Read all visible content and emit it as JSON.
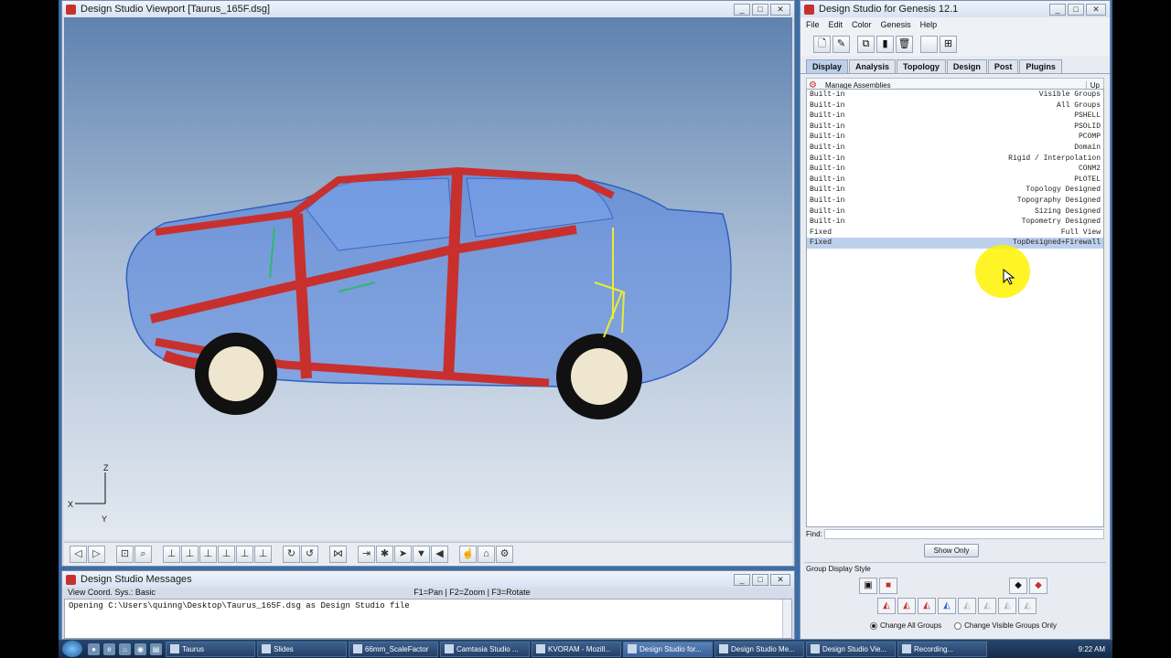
{
  "viewport": {
    "title": "Design Studio Viewport [Taurus_165F.dsg]",
    "axes": {
      "z": "Z",
      "x": "X",
      "y": "Y"
    }
  },
  "messages": {
    "title": "Design Studio Messages",
    "coord_sys": "View Coord. Sys.: Basic",
    "hotkeys": "F1=Pan | F2=Zoom | F3=Rotate",
    "log_line": "Opening C:\\Users\\quinng\\Desktop\\Taurus_165F.dsg as Design Studio file"
  },
  "genesis": {
    "title": "Design Studio for Genesis 12.1",
    "menu": [
      "File",
      "Edit",
      "Color",
      "Genesis",
      "Help"
    ],
    "tabs": [
      "Display",
      "Analysis",
      "Topology",
      "Design",
      "Post",
      "Plugins"
    ],
    "active_tab": "Display",
    "manage_assemblies": "Manage Assemblies",
    "up_label": "Up",
    "groups": [
      {
        "type": "Built-in",
        "name": "Visible Groups"
      },
      {
        "type": "Built-in",
        "name": "All Groups"
      },
      {
        "type": "Built-in",
        "name": "PSHELL"
      },
      {
        "type": "Built-in",
        "name": "PSOLID"
      },
      {
        "type": "Built-in",
        "name": "PCOMP"
      },
      {
        "type": "Built-in",
        "name": "Domain"
      },
      {
        "type": "Built-in",
        "name": "Rigid / Interpolation"
      },
      {
        "type": "Built-in",
        "name": "CONM2"
      },
      {
        "type": "Built-in",
        "name": "PLOTEL"
      },
      {
        "type": "Built-in",
        "name": "Topology Designed"
      },
      {
        "type": "Built-in",
        "name": "Topography Designed"
      },
      {
        "type": "Built-in",
        "name": "Sizing Designed"
      },
      {
        "type": "Built-in",
        "name": "Topometry Designed"
      },
      {
        "type": "Fixed",
        "name": "Full View"
      },
      {
        "type": "Fixed",
        "name": "TopDesigned+Firewall"
      }
    ],
    "find_label": "Find:",
    "find_value": "",
    "show_only": "Show Only",
    "group_display_style": "Group Display Style",
    "radio_all": "Change All Groups",
    "radio_visible": "Change Visible Groups Only"
  },
  "taskbar": {
    "items": [
      "Taurus",
      "Slides",
      "66mm_ScaleFactor",
      "Camtasia Studio ...",
      "KVORAM - Mozill...",
      "Design Studio for...",
      "Design Studio Me...",
      "Design Studio Vie...",
      "Recording..."
    ],
    "clock": "9:22 AM"
  },
  "colors": {
    "selected_row": "#bcd0ec",
    "body_red": "#c8302e",
    "shell_blue": "#4f7fe0",
    "highlight": "#fff200"
  }
}
